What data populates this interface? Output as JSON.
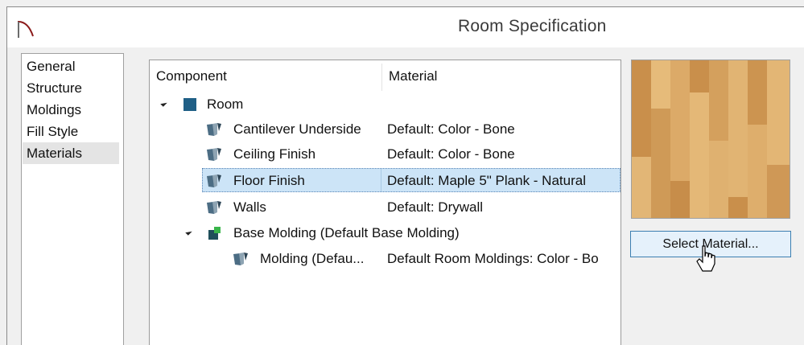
{
  "window": {
    "title": "Room Specification",
    "icon": "chief-architect-arch-icon"
  },
  "tabs": [
    {
      "label": "General",
      "selected": false
    },
    {
      "label": "Structure",
      "selected": false
    },
    {
      "label": "Moldings",
      "selected": false
    },
    {
      "label": "Fill Style",
      "selected": false
    },
    {
      "label": "Materials",
      "selected": true
    }
  ],
  "tree": {
    "columns": [
      "Component",
      "Material"
    ],
    "rows": [
      {
        "component": "Room",
        "material": "",
        "icon": "room-square-icon",
        "expandable": true
      },
      {
        "component": "Cantilever Underside",
        "material": "Default: Color - Bone",
        "icon": "material-swatch-icon"
      },
      {
        "component": "Ceiling Finish",
        "material": "Default: Color - Bone",
        "icon": "material-swatch-icon"
      },
      {
        "component": "Floor Finish",
        "material": "Default: Maple 5\" Plank - Natural",
        "icon": "material-swatch-icon",
        "selected": true
      },
      {
        "component": "Walls",
        "material": "Default: Drywall",
        "icon": "material-swatch-icon"
      },
      {
        "component": "Base Molding (Default Base Molding)",
        "material": "",
        "icon": "molding-icon",
        "expandable": true
      },
      {
        "component": "Molding (Defau...",
        "material": "Default Room Moldings: Color - Bo",
        "icon": "material-swatch-icon"
      }
    ]
  },
  "preview": {
    "description_icon": "maple-plank-texture-preview",
    "base_color": "#d9a866"
  },
  "buttons": {
    "select_material": "Select Material..."
  },
  "colors": {
    "selection": "#cce4f7",
    "room_icon": "#1f5f86",
    "molding_icon": "#1e8a9a"
  }
}
